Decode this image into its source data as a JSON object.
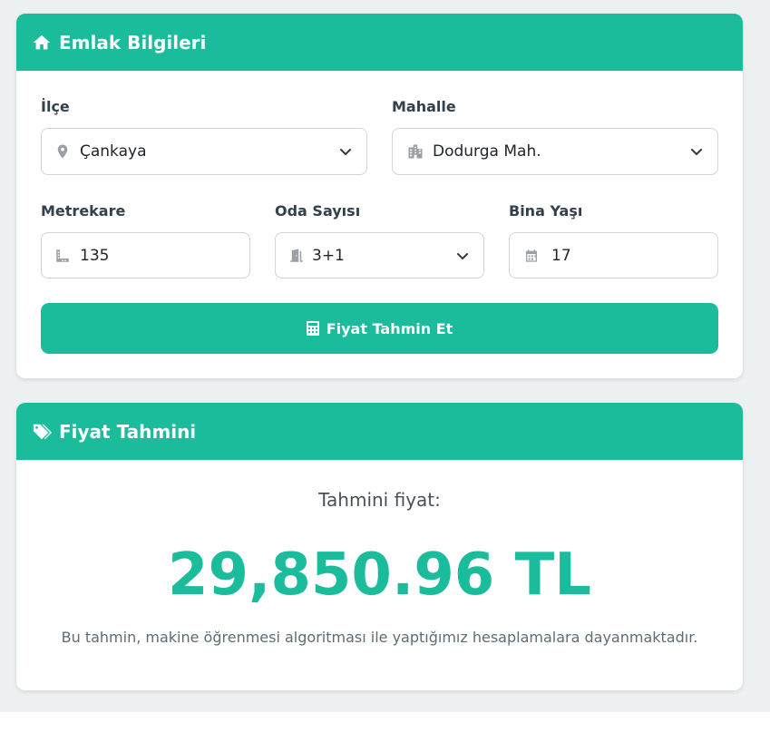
{
  "form_card": {
    "title": "Emlak Bilgileri",
    "icon": "home-icon",
    "district": {
      "label": "İlçe",
      "value": "Çankaya",
      "icon": "map-marker-icon"
    },
    "neighborhood": {
      "label": "Mahalle",
      "value": "Dodurga Mah.",
      "icon": "building-icon"
    },
    "area": {
      "label": "Metrekare",
      "value": "135",
      "icon": "ruler-icon"
    },
    "rooms": {
      "label": "Oda Sayısı",
      "value": "3+1",
      "icon": "door-icon"
    },
    "age": {
      "label": "Bina Yaşı",
      "value": "17",
      "icon": "calendar-icon"
    },
    "submit_label": "Fiyat Tahmin Et",
    "submit_icon": "calculator-icon"
  },
  "result_card": {
    "title": "Fiyat Tahmini",
    "icon": "tags-icon",
    "label": "Tahmini fiyat:",
    "price": "29,850.96 TL",
    "note": "Bu tahmin, makine öğrenmesi algoritması ile yaptığımız hesaplamalara dayanmaktadır."
  },
  "colors": {
    "accent": "#1abc9c",
    "background": "#eef1f2",
    "icon_gray": "#9aa0a6"
  }
}
